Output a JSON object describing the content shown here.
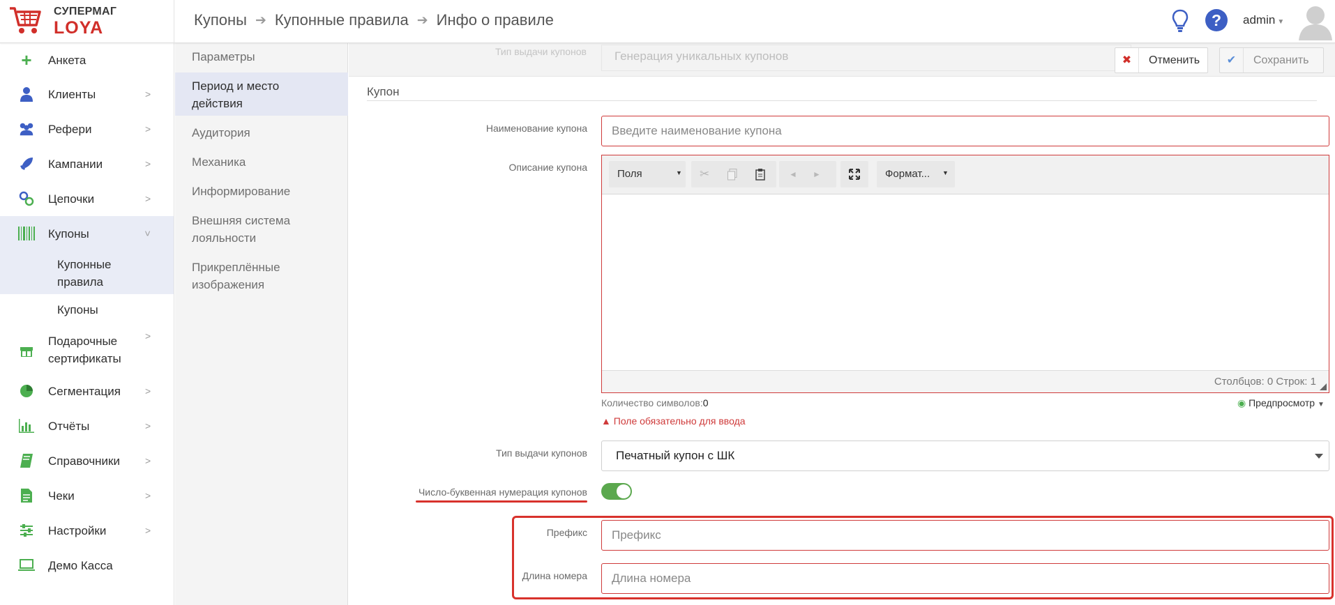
{
  "header": {
    "logo_top": "СУПЕРМАГ",
    "logo_bottom": "LOYA",
    "breadcrumb": [
      "Купоны",
      "Купонные правила",
      "Инфо о правиле"
    ],
    "username": "admin"
  },
  "sidebar": {
    "items": [
      {
        "label": "Анкета",
        "icon": "plus-icon"
      },
      {
        "label": "Клиенты",
        "icon": "user-icon"
      },
      {
        "label": "Рефери",
        "icon": "users-icon"
      },
      {
        "label": "Кампании",
        "icon": "rocket-icon"
      },
      {
        "label": "Цепочки",
        "icon": "link-icon"
      },
      {
        "label": "Купоны",
        "icon": "barcode-icon"
      },
      {
        "label": "Подарочные\nсертификаты",
        "icon": "gift-icon"
      },
      {
        "label": "Сегментация",
        "icon": "pie-chart-icon"
      },
      {
        "label": "Отчёты",
        "icon": "bar-chart-icon"
      },
      {
        "label": "Справочники",
        "icon": "book-icon"
      },
      {
        "label": "Чеки",
        "icon": "receipt-icon"
      },
      {
        "label": "Настройки",
        "icon": "sliders-icon"
      },
      {
        "label": "Демо Касса",
        "icon": "laptop-icon"
      }
    ],
    "sub_items": [
      "Купонные\nправила",
      "Купоны"
    ]
  },
  "sections": [
    "Параметры",
    "Период и место\nдействия",
    "Аудитория",
    "Механика",
    "Информирование",
    "Внешняя система\nлояльности",
    "Прикреплённые\nизображения"
  ],
  "form": {
    "faded_label": "Тип выдачи купонов",
    "faded_value": "Генерация уникальных купонов",
    "cancel_label": "Отменить",
    "save_label": "Сохранить",
    "legend": "Купон",
    "name_label": "Наименование купона",
    "name_placeholder": "Введите наименование купона",
    "desc_label": "Описание купона",
    "editor": {
      "fields_dropdown": "Поля",
      "format_dropdown": "Формат...",
      "status": "Столбцов: 0 Строк: 1"
    },
    "char_count_label": "Количество символов:",
    "char_count_value": "0",
    "preview_label": "Предпросмотр",
    "error_text": "Поле обязательно для ввода",
    "type_label": "Тип выдачи купонов",
    "type_value": "Печатный купон с ШК",
    "alnum_label": "Число-буквенная нумерация купонов",
    "alnum_enabled": true,
    "prefix_label": "Префикс",
    "prefix_placeholder": "Префикс",
    "length_label": "Длина номера",
    "length_placeholder": "Длина номера"
  }
}
